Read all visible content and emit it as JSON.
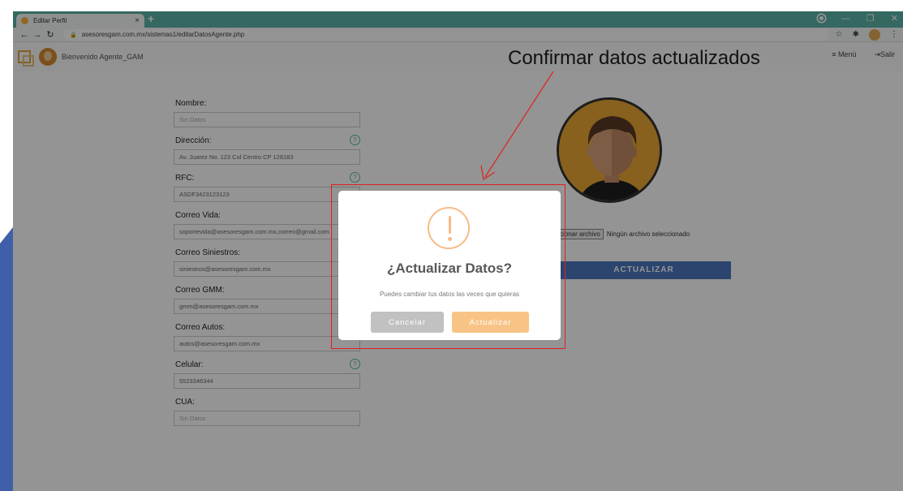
{
  "browser": {
    "tab_title": "Editar Perfil",
    "tab_close": "×",
    "new_tab": "+",
    "url": "asesoresgam.com.mx/sistemas1/editarDatosAgente.php"
  },
  "header": {
    "welcome": "Bienvenido Agente_GAM",
    "menu_label": "≡ Menú",
    "logout_label": "⇥Salir"
  },
  "form": {
    "fields": [
      {
        "label": "Nombre:",
        "value": "Sin Datos"
      },
      {
        "label": "Dirección:",
        "value": "Av. Juarez No. 123 Col Centro CP 128183"
      },
      {
        "label": "RFC:",
        "value": "ASDF3423123123"
      },
      {
        "label": "Correo Vida:",
        "value": "soportevida@asesoresgam.com.mx,correo@gmail.com"
      },
      {
        "label": "Correo Siniestros:",
        "value": "siniestros@asesoresgam.com.mx"
      },
      {
        "label": "Correo GMM:",
        "value": "gmm@asesoresgam.com.mx"
      },
      {
        "label": "Correo Autos:",
        "value": "autos@asesoresgam.com.mx"
      },
      {
        "label": "Celular:",
        "value": "5523346344"
      },
      {
        "label": "CUA:",
        "value": "Sin Datos"
      }
    ],
    "file_button": "ccionar archivo",
    "file_status": "Ningún archivo seleccionado",
    "update_button": "ACTUALIZAR"
  },
  "modal": {
    "title": "¿Actualizar Datos?",
    "text": "Puedes cambiar tus datos las veces que quieras",
    "cancel_label": "Cancelar",
    "confirm_label": "Actualizar"
  },
  "annotation": {
    "text": "Confirmar datos actualizados",
    "color": "#e02020"
  }
}
